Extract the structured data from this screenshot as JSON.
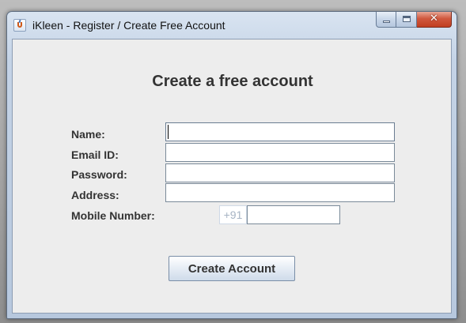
{
  "window": {
    "title": "iKleen - Register / Create Free Account",
    "close_glyph": "✕"
  },
  "form": {
    "heading": "Create a free account",
    "name_label": "Name:",
    "name_value": "",
    "email_label": "Email ID:",
    "email_value": "",
    "password_label": "Password:",
    "password_value": "",
    "address_label": "Address:",
    "address_value": "",
    "mobile_label": "Mobile Number:",
    "mobile_prefix": "+91",
    "mobile_value": "",
    "submit_label": "Create Account"
  },
  "icons": {
    "app": "java-cup-icon",
    "minimize": "minimize-icon",
    "maximize": "maximize-icon",
    "close": "close-icon"
  }
}
